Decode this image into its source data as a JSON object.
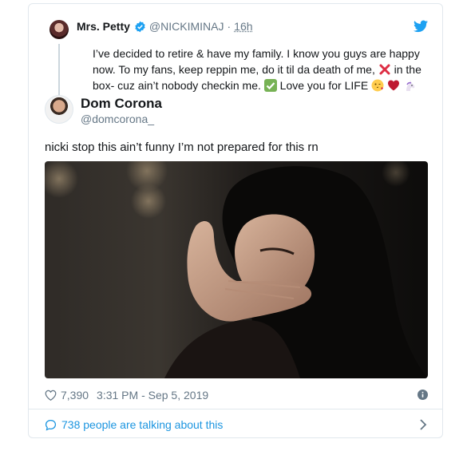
{
  "quoted_tweet": {
    "name": "Mrs. Petty",
    "handle": "@NICKIMINAJ",
    "separator": "·",
    "time": "16h",
    "text_part1": "I’ve decided to retire & have my family. I know you guys are happy now. To my fans, keep reppin me, do it til da death of me,",
    "text_part2": "in the box- cuz ain’t nobody checkin me.",
    "text_part3": "Love you for LIFE",
    "emojis": [
      "cross-mark-emoji",
      "check-mark-emoji",
      "kiss-face-emoji",
      "red-heart-emoji",
      "unicorn-emoji"
    ]
  },
  "tweet": {
    "name": "Dom Corona",
    "handle": "@domcorona_",
    "text": "nicki stop this ain’t funny I’m not prepared for this rn",
    "likes": "7,390",
    "timestamp": "3:31 PM - Sep 5, 2019"
  },
  "footer": {
    "conversation": "738 people are talking about this"
  },
  "colors": {
    "twitter_blue": "#1da1f2",
    "link_blue": "#1b95e0",
    "muted": "#657786",
    "border": "#e1e8ed"
  }
}
